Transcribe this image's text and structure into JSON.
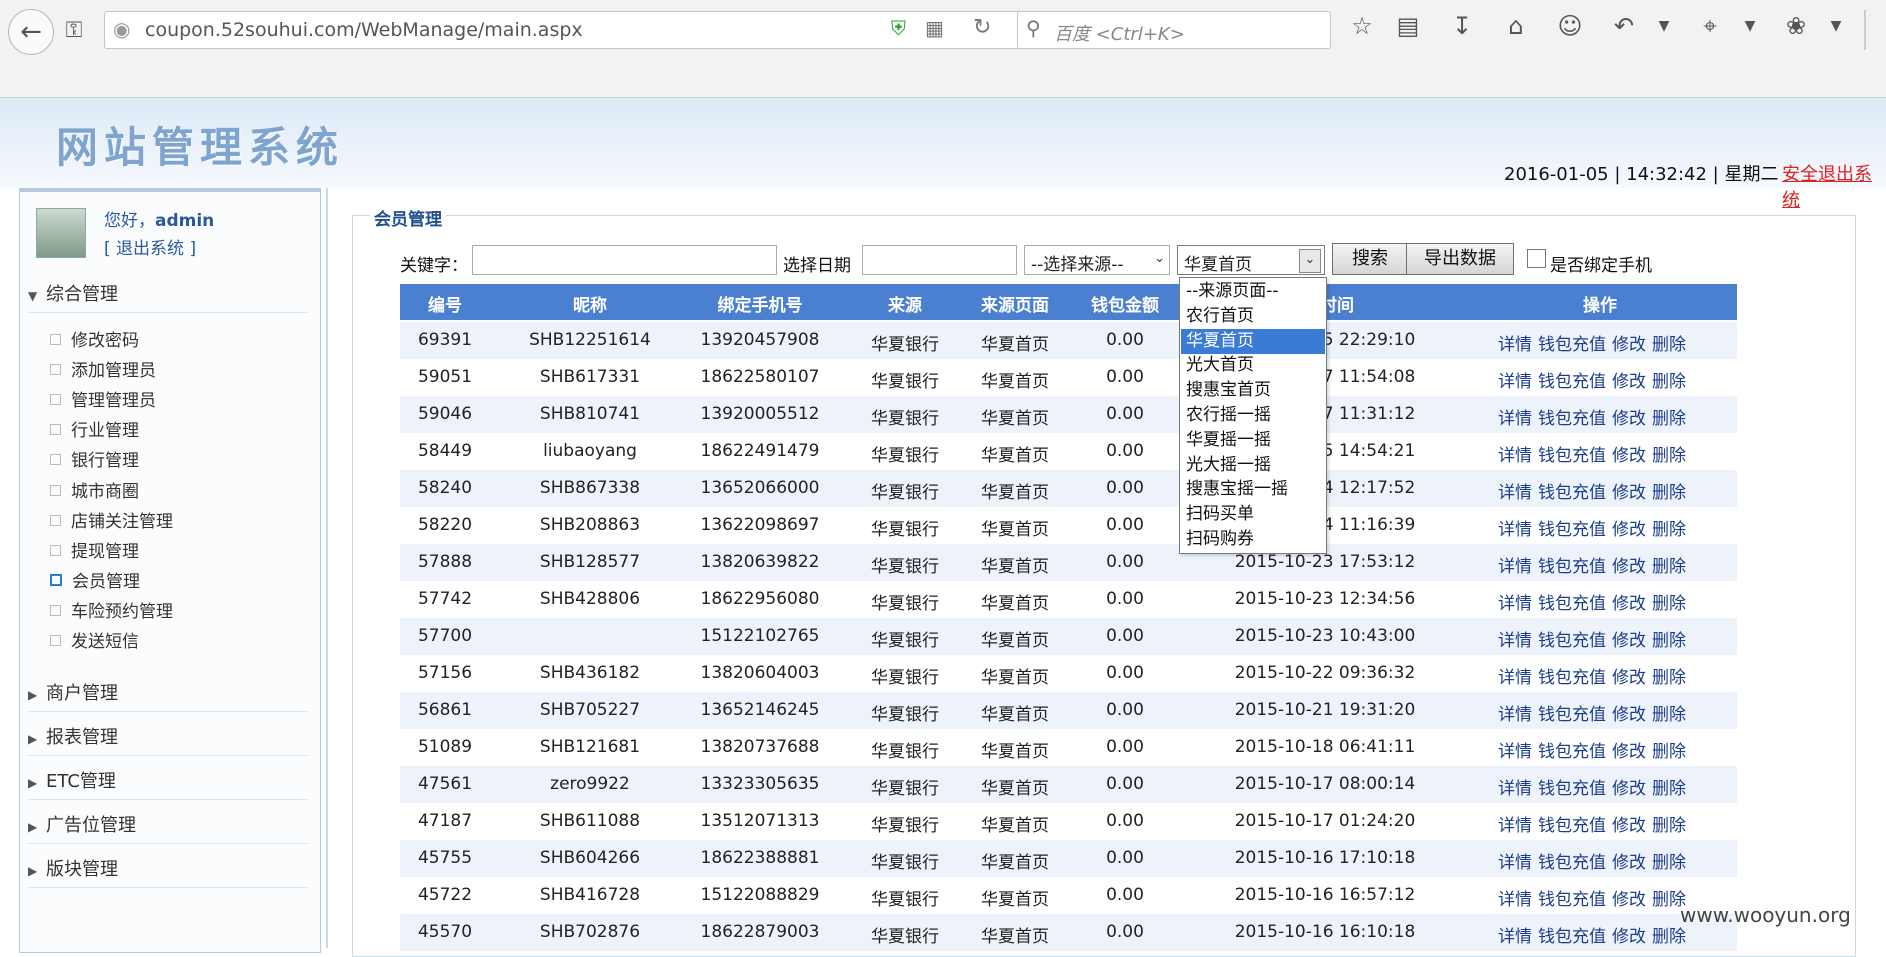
{
  "browser": {
    "url": "coupon.52souhui.com/WebManage/main.aspx",
    "search_placeholder": "百度 <Ctrl+K>"
  },
  "header": {
    "site_title": "网站管理系统",
    "datetime": "2016-01-05 | 14:32:42 | 星期二",
    "logout": "安全退出系统"
  },
  "sidebar": {
    "greeting": "您好，",
    "username": "admin",
    "logout": "[ 退出系统 ]",
    "sections": [
      {
        "label": "综合管理",
        "expanded": true,
        "items": [
          "修改密码",
          "添加管理员",
          "管理管理员",
          "行业管理",
          "银行管理",
          "城市商圈",
          "店铺关注管理",
          "提现管理",
          "会员管理",
          "车险预约管理",
          "发送短信"
        ],
        "active_item": "会员管理"
      },
      {
        "label": "商户管理",
        "expanded": false
      },
      {
        "label": "报表管理",
        "expanded": false
      },
      {
        "label": "ETC管理",
        "expanded": false
      },
      {
        "label": "广告位管理",
        "expanded": false
      },
      {
        "label": "版块管理",
        "expanded": false
      }
    ]
  },
  "main": {
    "panel_title": "会员管理",
    "filters": {
      "keyword_label": "关键字：",
      "keyword_value": "",
      "date_label": "选择日期",
      "date_value": "",
      "source_select": "--选择来源--",
      "page_select": "华夏首页",
      "search_button": "搜索",
      "export_button": "导出数据",
      "bind_phone_label": "是否绑定手机",
      "bind_phone_checked": false
    },
    "page_options": [
      "--来源页面--",
      "农行首页",
      "华夏首页",
      "光大首页",
      "搜惠宝首页",
      "农行摇一摇",
      "华夏摇一摇",
      "光大摇一摇",
      "搜惠宝摇一摇",
      "扫码买单",
      "扫码购券"
    ],
    "page_options_selected": 2,
    "columns": [
      "编号",
      "昵称",
      "绑定手机号",
      "来源",
      "来源页面",
      "钱包金额",
      "时间",
      "操作"
    ],
    "column_partial": "时间",
    "ops": [
      "详情",
      "钱包充值",
      "修改",
      "删除"
    ],
    "rows": [
      {
        "id": "69391",
        "nick": "SHB12251614",
        "phone": "13920457908",
        "source": "华夏银行",
        "page": "华夏首页",
        "amount": "0.00",
        "time": "2015-12-25 22:29:10"
      },
      {
        "id": "59051",
        "nick": "SHB617331",
        "phone": "18622580107",
        "source": "华夏银行",
        "page": "华夏首页",
        "amount": "0.00",
        "time": "2015-10-27 11:54:08"
      },
      {
        "id": "59046",
        "nick": "SHB810741",
        "phone": "13920005512",
        "source": "华夏银行",
        "page": "华夏首页",
        "amount": "0.00",
        "time": "2015-10-27 11:31:12"
      },
      {
        "id": "58449",
        "nick": "liubaoyang",
        "phone": "18622491479",
        "source": "华夏银行",
        "page": "华夏首页",
        "amount": "0.00",
        "time": "2015-10-25 14:54:21"
      },
      {
        "id": "58240",
        "nick": "SHB867338",
        "phone": "13652066000",
        "source": "华夏银行",
        "page": "华夏首页",
        "amount": "0.00",
        "time": "2015-10-24 12:17:52"
      },
      {
        "id": "58220",
        "nick": "SHB208863",
        "phone": "13622098697",
        "source": "华夏银行",
        "page": "华夏首页",
        "amount": "0.00",
        "time": "2015-10-24 11:16:39"
      },
      {
        "id": "57888",
        "nick": "SHB128577",
        "phone": "13820639822",
        "source": "华夏银行",
        "page": "华夏首页",
        "amount": "0.00",
        "time": "2015-10-23 17:53:12"
      },
      {
        "id": "57742",
        "nick": "SHB428806",
        "phone": "18622956080",
        "source": "华夏银行",
        "page": "华夏首页",
        "amount": "0.00",
        "time": "2015-10-23 12:34:56"
      },
      {
        "id": "57700",
        "nick": "",
        "phone": "15122102765",
        "source": "华夏银行",
        "page": "华夏首页",
        "amount": "0.00",
        "time": "2015-10-23 10:43:00"
      },
      {
        "id": "57156",
        "nick": "SHB436182",
        "phone": "13820604003",
        "source": "华夏银行",
        "page": "华夏首页",
        "amount": "0.00",
        "time": "2015-10-22 09:36:32"
      },
      {
        "id": "56861",
        "nick": "SHB705227",
        "phone": "13652146245",
        "source": "华夏银行",
        "page": "华夏首页",
        "amount": "0.00",
        "time": "2015-10-21 19:31:20"
      },
      {
        "id": "51089",
        "nick": "SHB121681",
        "phone": "13820737688",
        "source": "华夏银行",
        "page": "华夏首页",
        "amount": "0.00",
        "time": "2015-10-18 06:41:11"
      },
      {
        "id": "47561",
        "nick": "zero9922",
        "phone": "13323305635",
        "source": "华夏银行",
        "page": "华夏首页",
        "amount": "0.00",
        "time": "2015-10-17 08:00:14"
      },
      {
        "id": "47187",
        "nick": "SHB611088",
        "phone": "13512071313",
        "source": "华夏银行",
        "page": "华夏首页",
        "amount": "0.00",
        "time": "2015-10-17 01:24:20"
      },
      {
        "id": "45755",
        "nick": "SHB604266",
        "phone": "18622388881",
        "source": "华夏银行",
        "page": "华夏首页",
        "amount": "0.00",
        "time": "2015-10-16 17:10:18"
      },
      {
        "id": "45722",
        "nick": "SHB416728",
        "phone": "15122088829",
        "source": "华夏银行",
        "page": "华夏首页",
        "amount": "0.00",
        "time": "2015-10-16 16:57:12"
      },
      {
        "id": "45570",
        "nick": "SHB702876",
        "phone": "18622879003",
        "source": "华夏银行",
        "page": "华夏首页",
        "amount": "0.00",
        "time": "2015-10-16 16:10:18"
      }
    ]
  },
  "watermark": "www.wooyun.org",
  "colors": {
    "header_blue": "#4b7fd0",
    "link": "#1a3d8c",
    "logout_red": "#e02020"
  }
}
